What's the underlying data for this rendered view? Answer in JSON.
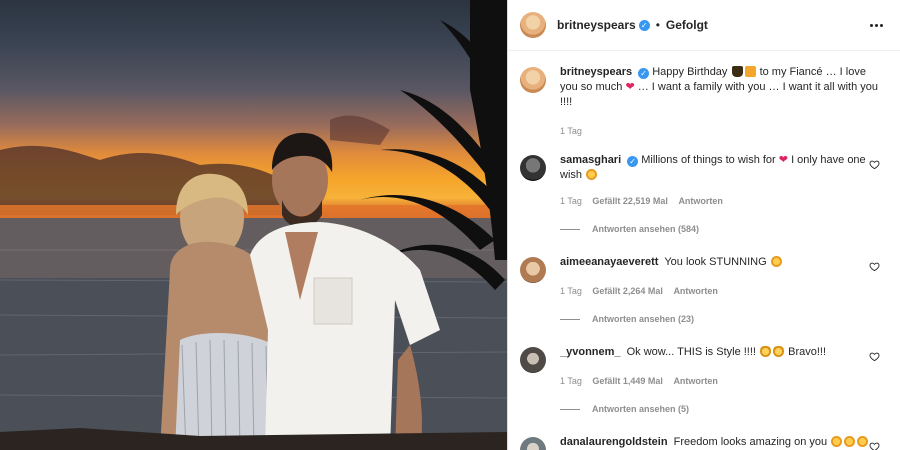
{
  "post": {
    "username": "britneyspears",
    "follow_status": "Gefolgt",
    "caption_part1": "Happy Birthday",
    "caption_part2": "to my Fiancé … I love you so much",
    "caption_part3": "… I want a family with you … I want it all with you !!!!",
    "time": "1 Tag"
  },
  "comments": [
    {
      "username": "samasghari",
      "verified": true,
      "text_part1": "Millions of things to wish for",
      "text_part2": "I only have one wish",
      "time": "1 Tag",
      "likes": "Gefällt 22,519 Mal",
      "reply": "Antworten",
      "view_replies": "Antworten ansehen (584)"
    },
    {
      "username": "aimeeanayaeverett",
      "text": "You look STUNNING",
      "time": "1 Tag",
      "likes": "Gefällt 2,264 Mal",
      "reply": "Antworten",
      "view_replies": "Antworten ansehen (23)"
    },
    {
      "username": "_yvonnem_",
      "text_part1": "Ok wow... THIS is Style !!!!",
      "text_part2": "Bravo!!!",
      "time": "1 Tag",
      "likes": "Gefällt 1,449 Mal",
      "reply": "Antworten",
      "view_replies": "Antworten ansehen (5)"
    },
    {
      "username": "danalaurengoldstein",
      "text": "Freedom looks amazing on you"
    }
  ],
  "colors": {
    "verified": "#3897f0",
    "muted": "#8e8e8e",
    "text": "#262626"
  }
}
